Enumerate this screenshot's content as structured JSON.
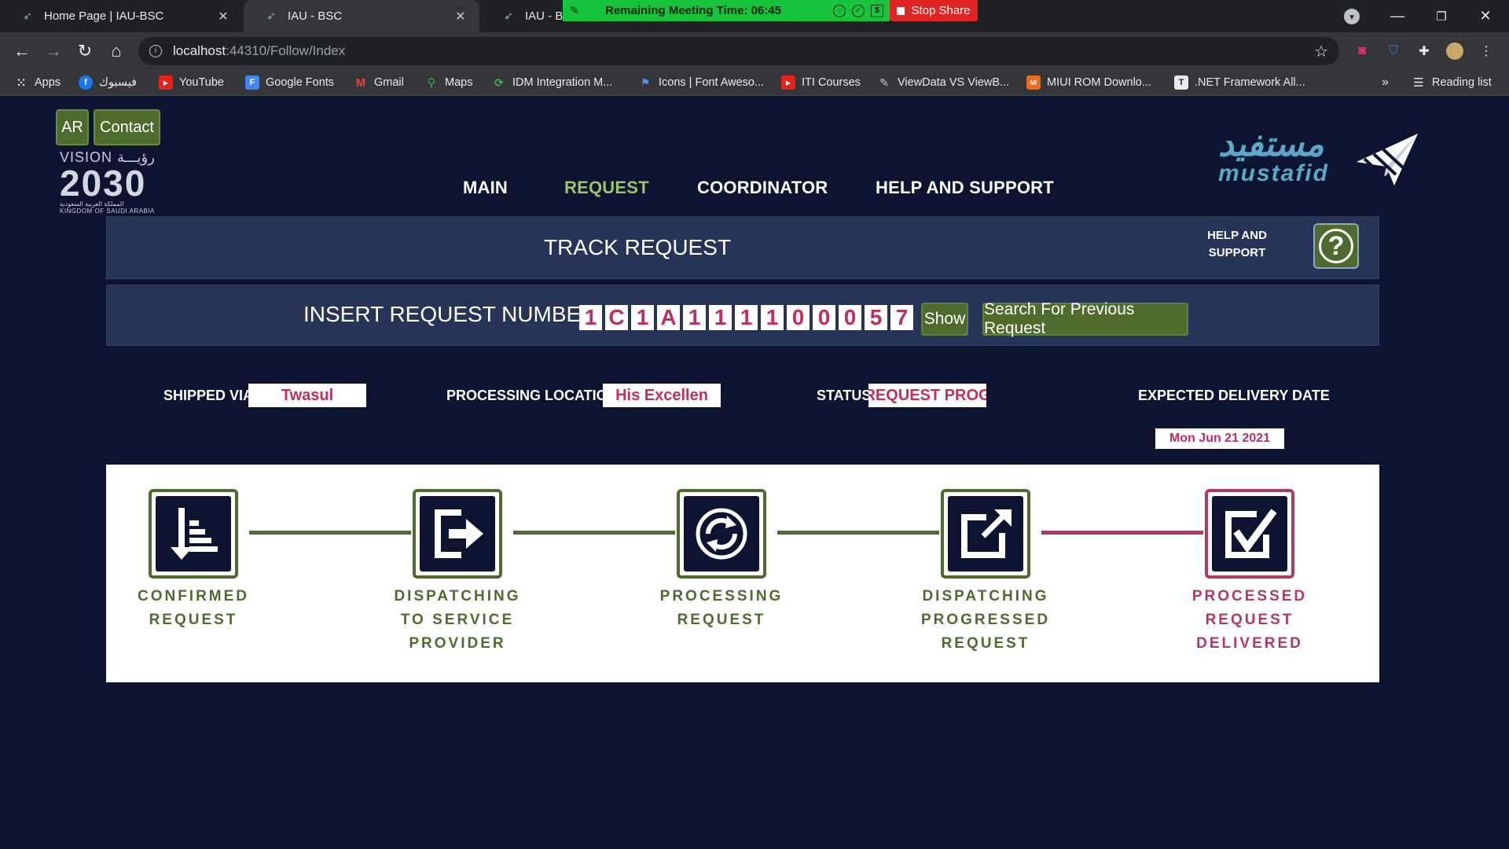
{
  "browser": {
    "tabs": [
      {
        "title": "Home Page | IAU-BSC",
        "close": "✕"
      },
      {
        "title": "IAU - BSC",
        "close": "✕"
      },
      {
        "title": "IAU - BSC",
        "close": ""
      }
    ],
    "meeting_label": "Remaining Meeting Time: 06:45",
    "stop_share_label": "Stop Share",
    "url_host": "localhost",
    "url_path": ":44310/Follow/Index",
    "bookmarks": [
      "Apps",
      "فيسبوك",
      "YouTube",
      "Google Fonts",
      "Gmail",
      "Maps",
      "IDM Integration M...",
      "Icons | Font Aweso...",
      "ITI Courses",
      "ViewData VS ViewB...",
      "MIUI ROM Downlo...",
      ".NET Framework All..."
    ],
    "bookmarks_overflow": "»",
    "reading_list": "Reading list"
  },
  "header": {
    "lang_button": "AR",
    "contact_button": "Contact",
    "vision_line1": "VISION رؤيـــة",
    "vision_year": "2030",
    "vision_line3": "المملكة العربية السعودية",
    "vision_line4": "KINGDOM OF SAUDI ARABIA",
    "logo_ar": "مستفيد",
    "logo_en": "mustafid",
    "nav": [
      "MAIN",
      "REQUEST",
      "COORDINATOR",
      "HELP AND SUPPORT"
    ],
    "nav_active": "REQUEST"
  },
  "track": {
    "title": "TRACK REQUEST",
    "help_line1": "HELP AND",
    "help_line2": "SUPPORT",
    "help_icon": "?"
  },
  "insert": {
    "label": "INSERT REQUEST NUMBER",
    "digits": [
      "1",
      "C",
      "1",
      "A",
      "1",
      "1",
      "1",
      "1",
      "0",
      "0",
      "0",
      "5",
      "7"
    ],
    "show_button": "Show",
    "search_button": "Search For Previous Request"
  },
  "details": {
    "shipped_via_label": "SHIPPED VIA",
    "shipped_via_value": "Twasul",
    "processing_location_label": "PROCESSING LOCATION",
    "processing_location_value": "His Excellen",
    "status_label": "STATUS",
    "status_value": "REQUEST PROG",
    "expected_delivery_label": "EXPECTED DELIVERY DATE",
    "expected_delivery_value": "Mon Jun 21 2021"
  },
  "steps": [
    {
      "line1": "CONFIRMED",
      "line2": "REQUEST",
      "line3": "",
      "icon": "sort-down-icon",
      "state": "done"
    },
    {
      "line1": "DISPATCHING",
      "line2": "TO SERVICE",
      "line3": "PROVIDER",
      "icon": "sign-out-icon",
      "state": "done"
    },
    {
      "line1": "PROCESSING",
      "line2": "REQUEST",
      "line3": "",
      "icon": "sync-icon",
      "state": "done"
    },
    {
      "line1": "DISPATCHING",
      "line2": "PROGRESSED",
      "line3": "REQUEST",
      "icon": "external-link-icon",
      "state": "done"
    },
    {
      "line1": "PROCESSED",
      "line2": "REQUEST",
      "line3": "DELIVERED",
      "icon": "check-square-icon",
      "state": "pending"
    }
  ],
  "colors": {
    "page_bg": "#0c1432",
    "panel_bg": "#253457",
    "green": "#4e6b2e",
    "active_nav": "#9bc36a",
    "pink": "#b2385e",
    "value_text": "#c0305a"
  }
}
